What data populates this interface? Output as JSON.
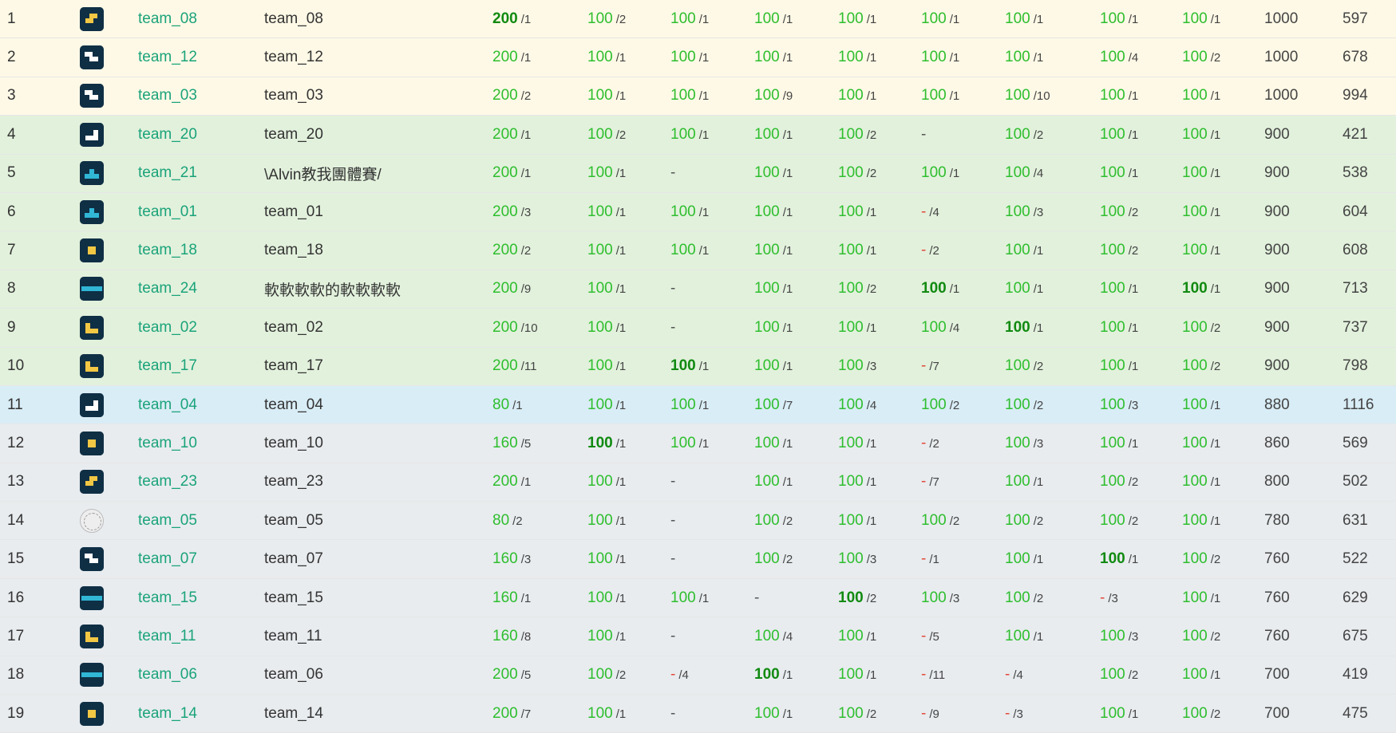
{
  "rows": [
    {
      "rank": "1",
      "style": "gold",
      "logo": "tetromino-s-yellow",
      "team": "team_08",
      "name": "team_08",
      "problems": [
        [
          "200",
          "/1",
          true
        ],
        [
          "100",
          "/2"
        ],
        [
          "100",
          "/1"
        ],
        [
          "100",
          "/1"
        ],
        [
          "100",
          "/1"
        ],
        [
          "100",
          "/1"
        ],
        [
          "100",
          "/1"
        ],
        [
          "100",
          "/1"
        ],
        [
          "100",
          "/1"
        ]
      ],
      "total": "1000",
      "penalty": "597"
    },
    {
      "rank": "2",
      "style": "gold",
      "logo": "tetromino-z-white",
      "team": "team_12",
      "name": "team_12",
      "problems": [
        [
          "200",
          "/1"
        ],
        [
          "100",
          "/1"
        ],
        [
          "100",
          "/1"
        ],
        [
          "100",
          "/1"
        ],
        [
          "100",
          "/1"
        ],
        [
          "100",
          "/1"
        ],
        [
          "100",
          "/1"
        ],
        [
          "100",
          "/4"
        ],
        [
          "100",
          "/2"
        ]
      ],
      "total": "1000",
      "penalty": "678"
    },
    {
      "rank": "3",
      "style": "gold",
      "logo": "tetromino-z-white",
      "team": "team_03",
      "name": "team_03",
      "problems": [
        [
          "200",
          "/2"
        ],
        [
          "100",
          "/1"
        ],
        [
          "100",
          "/1"
        ],
        [
          "100",
          "/9"
        ],
        [
          "100",
          "/1"
        ],
        [
          "100",
          "/1"
        ],
        [
          "100",
          "/10"
        ],
        [
          "100",
          "/1"
        ],
        [
          "100",
          "/1"
        ]
      ],
      "total": "1000",
      "penalty": "994"
    },
    {
      "rank": "4",
      "style": "green",
      "logo": "tetromino-j-white",
      "team": "team_20",
      "name": "team_20",
      "problems": [
        [
          "200",
          "/1"
        ],
        [
          "100",
          "/2"
        ],
        [
          "100",
          "/1"
        ],
        [
          "100",
          "/1"
        ],
        [
          "100",
          "/2"
        ],
        [
          "-",
          ""
        ],
        [
          "100",
          "/2"
        ],
        [
          "100",
          "/1"
        ],
        [
          "100",
          "/1"
        ]
      ],
      "total": "900",
      "penalty": "421"
    },
    {
      "rank": "5",
      "style": "green",
      "logo": "tetromino-t-cyan",
      "team": "team_21",
      "name": "\\Alvin教我團體賽/",
      "problems": [
        [
          "200",
          "/1"
        ],
        [
          "100",
          "/1"
        ],
        [
          "-",
          ""
        ],
        [
          "100",
          "/1"
        ],
        [
          "100",
          "/2"
        ],
        [
          "100",
          "/1"
        ],
        [
          "100",
          "/4"
        ],
        [
          "100",
          "/1"
        ],
        [
          "100",
          "/1"
        ]
      ],
      "total": "900",
      "penalty": "538"
    },
    {
      "rank": "6",
      "style": "green",
      "logo": "tetromino-t-cyan",
      "team": "team_01",
      "name": "team_01",
      "problems": [
        [
          "200",
          "/3"
        ],
        [
          "100",
          "/1"
        ],
        [
          "100",
          "/1"
        ],
        [
          "100",
          "/1"
        ],
        [
          "100",
          "/1"
        ],
        [
          "-",
          "/4",
          false,
          true
        ],
        [
          "100",
          "/3"
        ],
        [
          "100",
          "/2"
        ],
        [
          "100",
          "/1"
        ]
      ],
      "total": "900",
      "penalty": "604"
    },
    {
      "rank": "7",
      "style": "green",
      "logo": "tetromino-o-yellow",
      "team": "team_18",
      "name": "team_18",
      "problems": [
        [
          "200",
          "/2"
        ],
        [
          "100",
          "/1"
        ],
        [
          "100",
          "/1"
        ],
        [
          "100",
          "/1"
        ],
        [
          "100",
          "/1"
        ],
        [
          "-",
          "/2",
          false,
          true
        ],
        [
          "100",
          "/1"
        ],
        [
          "100",
          "/2"
        ],
        [
          "100",
          "/1"
        ]
      ],
      "total": "900",
      "penalty": "608"
    },
    {
      "rank": "8",
      "style": "green",
      "logo": "tetromino-i-cyan",
      "team": "team_24",
      "name": "軟軟軟軟的軟軟軟軟",
      "problems": [
        [
          "200",
          "/9"
        ],
        [
          "100",
          "/1"
        ],
        [
          "-",
          ""
        ],
        [
          "100",
          "/1"
        ],
        [
          "100",
          "/2"
        ],
        [
          "100",
          "/1",
          true
        ],
        [
          "100",
          "/1"
        ],
        [
          "100",
          "/1"
        ],
        [
          "100",
          "/1",
          true
        ]
      ],
      "total": "900",
      "penalty": "713"
    },
    {
      "rank": "9",
      "style": "green",
      "logo": "tetromino-l-yellow",
      "team": "team_02",
      "name": "team_02",
      "problems": [
        [
          "200",
          "/10"
        ],
        [
          "100",
          "/1"
        ],
        [
          "-",
          ""
        ],
        [
          "100",
          "/1"
        ],
        [
          "100",
          "/1"
        ],
        [
          "100",
          "/4"
        ],
        [
          "100",
          "/1",
          true
        ],
        [
          "100",
          "/1"
        ],
        [
          "100",
          "/2"
        ]
      ],
      "total": "900",
      "penalty": "737"
    },
    {
      "rank": "10",
      "style": "green",
      "logo": "tetromino-l-yellow",
      "team": "team_17",
      "name": "team_17",
      "problems": [
        [
          "200",
          "/11"
        ],
        [
          "100",
          "/1"
        ],
        [
          "100",
          "/1",
          true
        ],
        [
          "100",
          "/1"
        ],
        [
          "100",
          "/3"
        ],
        [
          "-",
          "/7",
          false,
          true
        ],
        [
          "100",
          "/2"
        ],
        [
          "100",
          "/1"
        ],
        [
          "100",
          "/2"
        ]
      ],
      "total": "900",
      "penalty": "798"
    },
    {
      "rank": "11",
      "style": "blue",
      "logo": "tetromino-j-white",
      "team": "team_04",
      "name": "team_04",
      "problems": [
        [
          "80",
          "/1"
        ],
        [
          "100",
          "/1"
        ],
        [
          "100",
          "/1"
        ],
        [
          "100",
          "/7"
        ],
        [
          "100",
          "/4"
        ],
        [
          "100",
          "/2"
        ],
        [
          "100",
          "/2"
        ],
        [
          "100",
          "/3"
        ],
        [
          "100",
          "/1"
        ]
      ],
      "total": "880",
      "penalty": "1116"
    },
    {
      "rank": "12",
      "style": "gray",
      "logo": "tetromino-o-yellow",
      "team": "team_10",
      "name": "team_10",
      "problems": [
        [
          "160",
          "/5"
        ],
        [
          "100",
          "/1",
          true
        ],
        [
          "100",
          "/1"
        ],
        [
          "100",
          "/1"
        ],
        [
          "100",
          "/1"
        ],
        [
          "-",
          "/2",
          false,
          true
        ],
        [
          "100",
          "/3"
        ],
        [
          "100",
          "/1"
        ],
        [
          "100",
          "/1"
        ]
      ],
      "total": "860",
      "penalty": "569"
    },
    {
      "rank": "13",
      "style": "gray",
      "logo": "tetromino-s-yellow",
      "team": "team_23",
      "name": "team_23",
      "problems": [
        [
          "200",
          "/1"
        ],
        [
          "100",
          "/1"
        ],
        [
          "-",
          ""
        ],
        [
          "100",
          "/1"
        ],
        [
          "100",
          "/1"
        ],
        [
          "-",
          "/7",
          false,
          true
        ],
        [
          "100",
          "/1"
        ],
        [
          "100",
          "/2"
        ],
        [
          "100",
          "/1"
        ]
      ],
      "total": "800",
      "penalty": "502"
    },
    {
      "rank": "14",
      "style": "gray",
      "logo": "seal",
      "team": "team_05",
      "name": "team_05",
      "problems": [
        [
          "80",
          "/2"
        ],
        [
          "100",
          "/1"
        ],
        [
          "-",
          ""
        ],
        [
          "100",
          "/2"
        ],
        [
          "100",
          "/1"
        ],
        [
          "100",
          "/2"
        ],
        [
          "100",
          "/2"
        ],
        [
          "100",
          "/2"
        ],
        [
          "100",
          "/1"
        ]
      ],
      "total": "780",
      "penalty": "631"
    },
    {
      "rank": "15",
      "style": "gray",
      "logo": "tetromino-z-white",
      "team": "team_07",
      "name": "team_07",
      "problems": [
        [
          "160",
          "/3"
        ],
        [
          "100",
          "/1"
        ],
        [
          "-",
          ""
        ],
        [
          "100",
          "/2"
        ],
        [
          "100",
          "/3"
        ],
        [
          "-",
          "/1",
          false,
          true
        ],
        [
          "100",
          "/1"
        ],
        [
          "100",
          "/1",
          true
        ],
        [
          "100",
          "/2"
        ]
      ],
      "total": "760",
      "penalty": "522"
    },
    {
      "rank": "16",
      "style": "gray",
      "logo": "tetromino-i-cyan",
      "team": "team_15",
      "name": "team_15",
      "problems": [
        [
          "160",
          "/1"
        ],
        [
          "100",
          "/1"
        ],
        [
          "100",
          "/1"
        ],
        [
          "-",
          ""
        ],
        [
          "100",
          "/2",
          true
        ],
        [
          "100",
          "/3"
        ],
        [
          "100",
          "/2"
        ],
        [
          "-",
          "/3",
          false,
          true
        ],
        [
          "100",
          "/1"
        ]
      ],
      "total": "760",
      "penalty": "629"
    },
    {
      "rank": "17",
      "style": "gray",
      "logo": "tetromino-l-yellow",
      "team": "team_11",
      "name": "team_11",
      "problems": [
        [
          "160",
          "/8"
        ],
        [
          "100",
          "/1"
        ],
        [
          "-",
          ""
        ],
        [
          "100",
          "/4"
        ],
        [
          "100",
          "/1"
        ],
        [
          "-",
          "/5",
          false,
          true
        ],
        [
          "100",
          "/1"
        ],
        [
          "100",
          "/3"
        ],
        [
          "100",
          "/2"
        ]
      ],
      "total": "760",
      "penalty": "675"
    },
    {
      "rank": "18",
      "style": "gray",
      "logo": "tetromino-i-cyan",
      "team": "team_06",
      "name": "team_06",
      "problems": [
        [
          "200",
          "/5"
        ],
        [
          "100",
          "/2"
        ],
        [
          "-",
          "/4",
          false,
          true
        ],
        [
          "100",
          "/1",
          true
        ],
        [
          "100",
          "/1"
        ],
        [
          "-",
          "/11",
          false,
          true
        ],
        [
          "-",
          "/4",
          false,
          true
        ],
        [
          "100",
          "/2"
        ],
        [
          "100",
          "/1"
        ]
      ],
      "total": "700",
      "penalty": "419"
    },
    {
      "rank": "19",
      "style": "gray",
      "logo": "tetromino-o-yellow",
      "team": "team_14",
      "name": "team_14",
      "problems": [
        [
          "200",
          "/7"
        ],
        [
          "100",
          "/1"
        ],
        [
          "-",
          ""
        ],
        [
          "100",
          "/1"
        ],
        [
          "100",
          "/2"
        ],
        [
          "-",
          "/9",
          false,
          true
        ],
        [
          "-",
          "/3",
          false,
          true
        ],
        [
          "100",
          "/1"
        ],
        [
          "100",
          "/2"
        ]
      ],
      "total": "700",
      "penalty": "475"
    }
  ],
  "colors": {
    "solved": "#2ebe2e",
    "first_solve": "#118a11",
    "failed": "#e24a3b",
    "team_link": "#1aa37a"
  }
}
